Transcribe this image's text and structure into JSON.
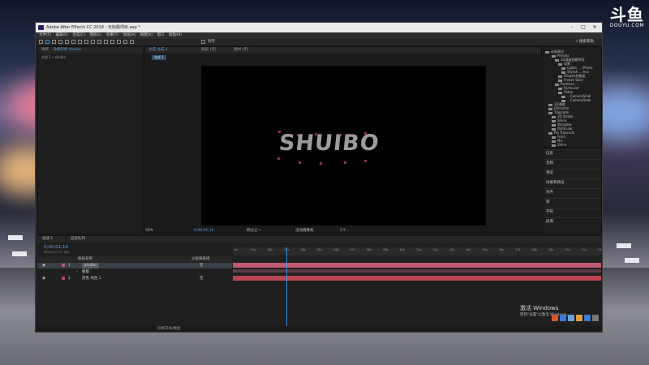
{
  "watermark": {
    "logo": "斗鱼",
    "url": "DOUYU.COM"
  },
  "window": {
    "title": "Adobe After Effects CC 2018 - 无标题项目.aep *"
  },
  "menu": [
    "文件(F)",
    "编辑(E)",
    "合成(C)",
    "图层(L)",
    "效果(T)",
    "动画(A)",
    "视图(V)",
    "窗口",
    "帮助(H)"
  ],
  "toolbar": {
    "align_label": "对齐",
    "search_label": "搜索帮助"
  },
  "project_panel": {
    "tab_label": "项目",
    "effects_tab": "效果控件 shuibo",
    "breadcrumb": "合成 1 • shuibo"
  },
  "comp_panel": {
    "tab_label": "合成 合成 1",
    "comp_name": "合成 1",
    "layer_tab": "图层 (无)",
    "footage_tab": "素材 (无)",
    "logo_text": "SHUIBO"
  },
  "viewer_bar": {
    "zoom": "50%",
    "timecode": "0;00;01;14",
    "resolution": "四分之一",
    "camera": "活动摄像机",
    "views": "1个..."
  },
  "effects_tree": [
    "动画预设",
    "Presets",
    "3D通道图層预设",
    "背景",
    "Lights ... (Photo",
    "Stylish ... eva",
    "Shapes的跳蚤",
    "Freeze Slice",
    "Particles ...",
    "Particular",
    "Video",
    "...CameraShak",
    "...CameraShak",
    "3D通道",
    "EXtractor",
    "Trapcode",
    "3D Stroke",
    "Shine",
    "Starglow",
    "Particular",
    "RG Trapcode",
    "Form",
    "Mir",
    "Shine"
  ],
  "right_list": [
    "信息",
    "音频",
    "预览",
    "效果和预设",
    "对齐",
    "库",
    "字符",
    "段落"
  ],
  "timeline": {
    "tab_comp": "合成 1",
    "tab_render": "渲染队列",
    "time": "0;00;01;14",
    "fps": "00044 (29.97 fps)",
    "column_name": "图层名称",
    "column_parent": "父级和链接",
    "layers": [
      {
        "num": "1",
        "name": "shuibo",
        "parent": "无"
      },
      {
        "num": "",
        "name": "蒙版",
        "parent": ""
      },
      {
        "num": "2",
        "name": "黑色 纯色 1",
        "parent": "无"
      }
    ],
    "ruler_ticks": [
      "0s",
      "01s",
      "02s",
      "03s",
      "04s",
      "05s",
      "06s",
      "07s",
      "08s",
      "09s",
      "10s",
      "11s",
      "12s",
      "13s",
      "14s",
      "15s",
      "16s",
      "17s",
      "18s",
      "19s",
      "20s",
      "21s",
      "22s"
    ],
    "mode_label": "切换开关/模式"
  },
  "windows_watermark": {
    "line1": "激活 Windows",
    "line2": "转到\"设置\"以激活 Windows。"
  },
  "colors": {
    "accent": "#3b8ad8",
    "layer1": "#c25a72",
    "layer2": "#b8454f"
  }
}
